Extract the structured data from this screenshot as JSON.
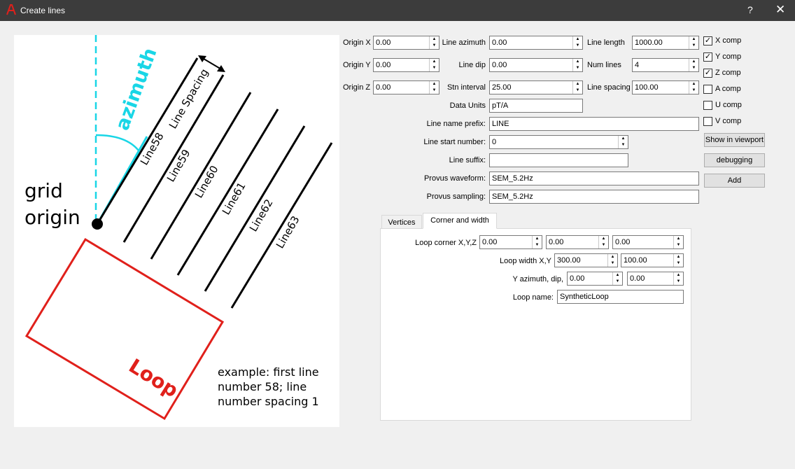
{
  "window": {
    "title": "Create lines",
    "help_glyph": "?",
    "close_glyph": "✕",
    "accent_color": "#e0201b"
  },
  "diagram": {
    "grid_origin_lines": [
      "grid",
      "origin"
    ],
    "azimuth": "azimuth",
    "line_spacing": "Line Spacing",
    "line_labels": [
      "Line58",
      "Line59",
      "Line60",
      "Line61",
      "Line62",
      "Line63"
    ],
    "loop": "Loop",
    "example_lines": [
      "example: first line",
      "number 58; line",
      "number spacing 1"
    ],
    "colors": {
      "azimuth": "#19d6e6",
      "loop": "#e0201b",
      "lines": "#000000"
    }
  },
  "form": {
    "origin_x": {
      "label": "Origin X",
      "value": "0.00"
    },
    "origin_y": {
      "label": "Origin Y",
      "value": "0.00"
    },
    "origin_z": {
      "label": "Origin Z",
      "value": "0.00"
    },
    "line_azimuth": {
      "label": "Line azimuth",
      "value": "0.00"
    },
    "line_dip": {
      "label": "Line dip",
      "value": "0.00"
    },
    "stn_interval": {
      "label": "Stn interval",
      "value": "25.00"
    },
    "line_length": {
      "label": "Line length",
      "value": "1000.00"
    },
    "num_lines": {
      "label": "Num lines",
      "value": "4"
    },
    "line_spacing": {
      "label": "Line spacing",
      "value": "100.00"
    },
    "data_units": {
      "label": "Data Units",
      "value": "pT/A"
    },
    "line_name_prefix": {
      "label": "Line name prefix:",
      "value": "LINE"
    },
    "line_start_number": {
      "label": "Line start number:",
      "value": "0"
    },
    "line_suffix": {
      "label": "Line suffix:",
      "value": ""
    },
    "provus_waveform": {
      "label": "Provus waveform:",
      "value": "SEM_5.2Hz"
    },
    "provus_sampling": {
      "label": "Provus sampling:",
      "value": "SEM_5.2Hz"
    }
  },
  "components": [
    {
      "label": "X comp",
      "checked": true,
      "mark": "✓"
    },
    {
      "label": "Y comp",
      "checked": true,
      "mark": "✓"
    },
    {
      "label": "Z comp",
      "checked": true,
      "mark": "✓"
    },
    {
      "label": "A comp",
      "checked": false,
      "mark": ""
    },
    {
      "label": "U comp",
      "checked": false,
      "mark": ""
    },
    {
      "label": "V comp",
      "checked": false,
      "mark": ""
    }
  ],
  "buttons": {
    "show_in_viewport": "Show in viewport",
    "debugging": "debugging",
    "add": "Add"
  },
  "tabs": [
    {
      "label": "Vertices",
      "active": false
    },
    {
      "label": "Corner and width",
      "active": true
    }
  ],
  "corner_width": {
    "loop_corner": {
      "label": "Loop corner X,Y,Z",
      "values": [
        "0.00",
        "0.00",
        "0.00"
      ]
    },
    "loop_width": {
      "label": "Loop width X,Y",
      "values": [
        "300.00",
        "100.00"
      ]
    },
    "y_azimuth_dip": {
      "label": "Y azimuth, dip,",
      "values": [
        "0.00",
        "0.00"
      ]
    },
    "loop_name": {
      "label": "Loop name:",
      "value": "SyntheticLoop"
    }
  }
}
